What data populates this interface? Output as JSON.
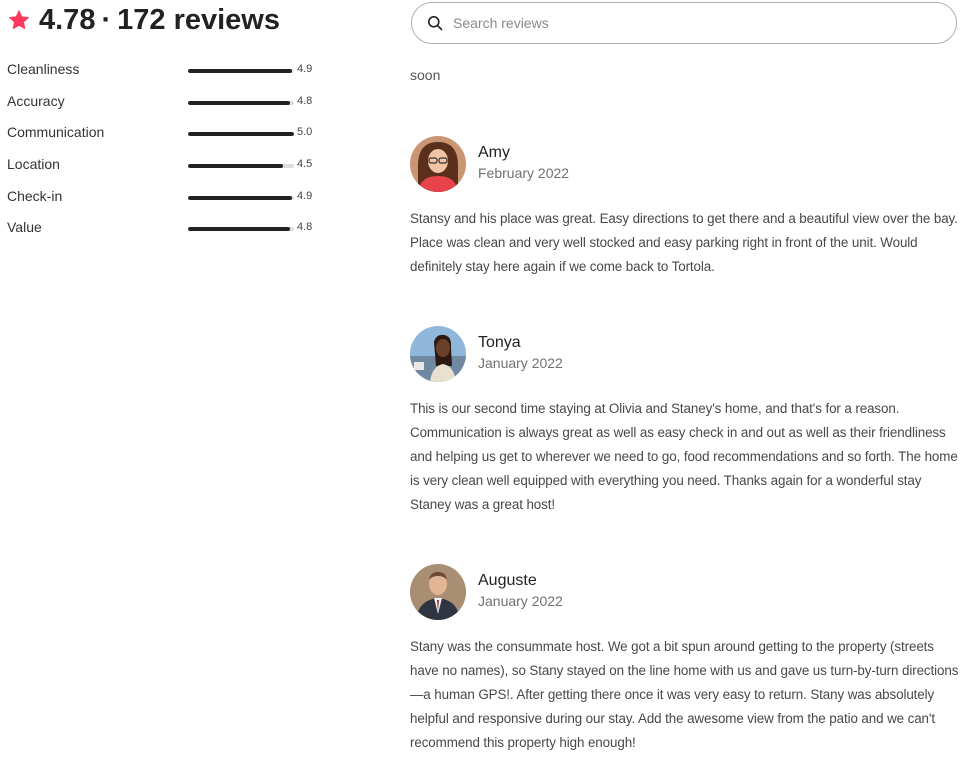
{
  "summary": {
    "rating": "4.78",
    "separator": "·",
    "reviews_label": "172 reviews",
    "accent_color": "#FF385C",
    "categories": [
      {
        "label": "Cleanliness",
        "score": "4.9",
        "fraction": 0.98
      },
      {
        "label": "Accuracy",
        "score": "4.8",
        "fraction": 0.96
      },
      {
        "label": "Communication",
        "score": "5.0",
        "fraction": 1.0
      },
      {
        "label": "Location",
        "score": "4.5",
        "fraction": 0.9
      },
      {
        "label": "Check-in",
        "score": "4.9",
        "fraction": 0.98
      },
      {
        "label": "Value",
        "score": "4.8",
        "fraction": 0.96
      }
    ]
  },
  "search": {
    "placeholder": "Search reviews",
    "value": ""
  },
  "partial_text": "soon",
  "reviews": [
    {
      "name": "Amy",
      "date": "February 2022",
      "text": "Stansy and his place was great. Easy directions to get there and a beautiful view over the bay. Place was clean and very well stocked and easy parking right in front of the unit. Would definitely stay here again if we come back to Tortola."
    },
    {
      "name": "Tonya",
      "date": "January 2022",
      "text": "This is our second time staying at Olivia and Staney's home, and that's for a reason. Communication is always great as well as easy check in and out as well as their friendliness and helping us get to wherever we need to go, food recommendations and so forth. The home is very clean well equipped with everything you need. Thanks again for a wonderful stay Staney was a great host!"
    },
    {
      "name": "Auguste",
      "date": "January 2022",
      "text": "Stany was the consummate host. We got a bit spun around getting to the property (streets have no names), so Stany stayed on the line home with us and gave us turn-by-turn directions—a human GPS!. After getting there once it was very easy to return. Stany was absolutely helpful and responsive during our stay. Add the awesome view from the patio and we can't recommend this property high enough!"
    }
  ]
}
